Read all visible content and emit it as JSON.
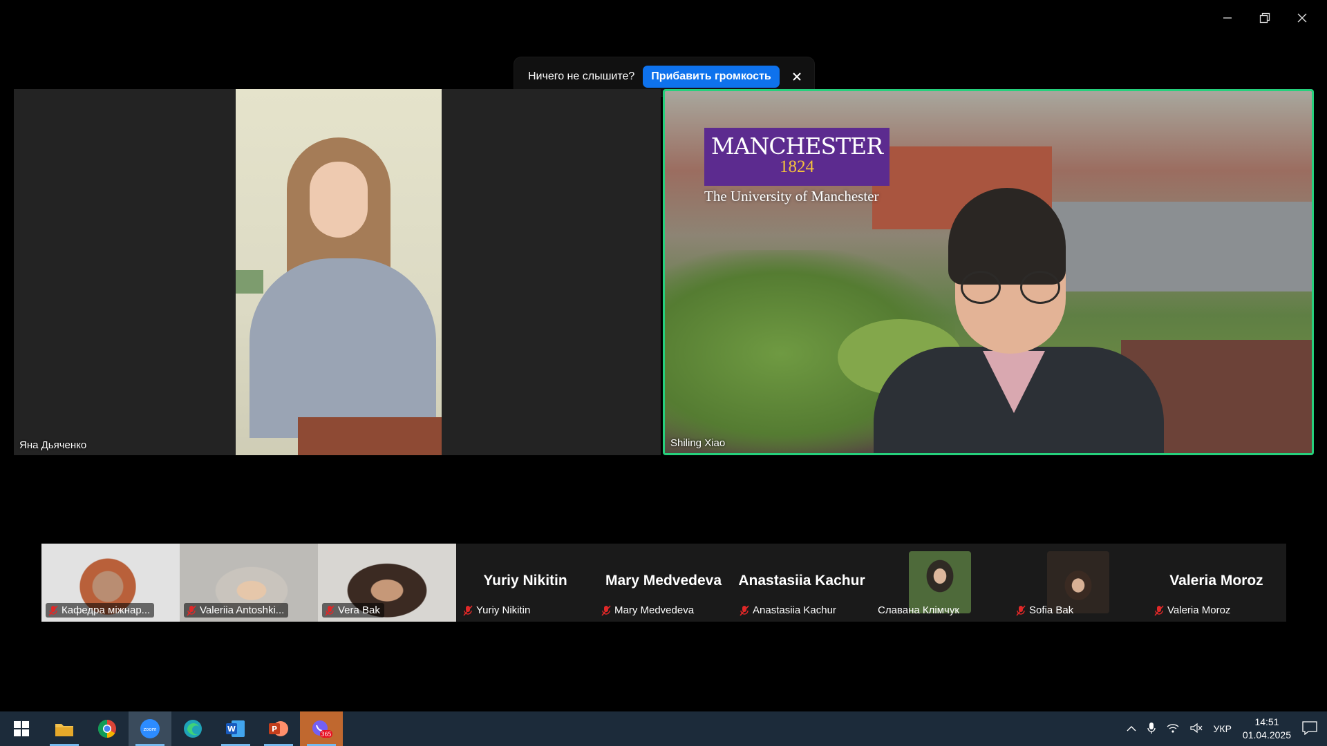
{
  "banner": {
    "text": "Ничего не слышите?",
    "button_label": "Прибавить громкость",
    "close_icon": "close-icon"
  },
  "window_controls": [
    "minimize-icon",
    "restore-icon",
    "close-icon"
  ],
  "main_tiles": {
    "left": {
      "name": "Яна Дьяченко"
    },
    "right": {
      "name": "Shiling Xiao",
      "logo_text": "MANCHESTER",
      "logo_year": "1824",
      "logo_subtitle": "The University of Manchester",
      "active_speaker_color": "#26d07c"
    }
  },
  "gallery": [
    {
      "name": "Кафедра міжнар...",
      "muted": true,
      "type": "video"
    },
    {
      "name": "Valeriia Antoshki...",
      "muted": true,
      "type": "video"
    },
    {
      "name": "Vera Bak",
      "muted": true,
      "type": "video"
    },
    {
      "name": "Yuriy Nikitin",
      "display_name": "Yuriy Nikitin",
      "muted": true,
      "type": "name"
    },
    {
      "name": "Mary Medvedeva",
      "display_name": "Mary Medvedeva",
      "muted": true,
      "type": "name"
    },
    {
      "name": "Anastasiia Kachur",
      "display_name": "Anastasiia Kachur",
      "muted": true,
      "type": "name"
    },
    {
      "name": "Славана Клімчук",
      "muted": false,
      "type": "avatar"
    },
    {
      "name": "Sofia Bak",
      "muted": true,
      "type": "avatar"
    },
    {
      "name": "Valeria Moroz",
      "display_name": "Valeria Moroz",
      "muted": true,
      "type": "name"
    }
  ],
  "taskbar": {
    "apps": [
      "windows-start-icon",
      "file-explorer-icon",
      "chrome-icon",
      "zoom-icon",
      "edge-icon",
      "word-icon",
      "powerpoint-icon",
      "viber-icon"
    ],
    "viber_badge": "365",
    "language": "УКР",
    "time": "14:51",
    "date": "01.04.2025"
  }
}
